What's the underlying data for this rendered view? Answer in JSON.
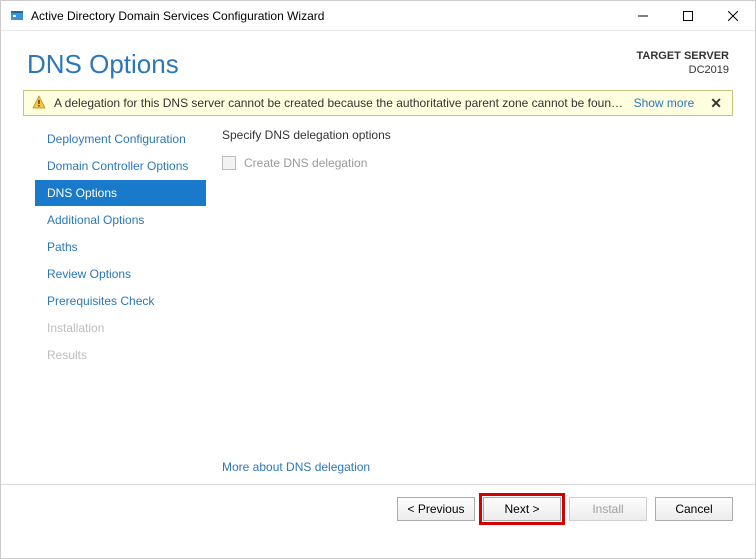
{
  "window": {
    "title": "Active Directory Domain Services Configuration Wizard"
  },
  "header": {
    "page_title": "DNS Options",
    "target_label": "TARGET SERVER",
    "target_server": "DC2019"
  },
  "warning": {
    "text": "A delegation for this DNS server cannot be created because the authoritative parent zone cannot be found...",
    "show_more": "Show more",
    "close": "×"
  },
  "nav": {
    "items": [
      {
        "label": "Deployment Configuration",
        "state": "normal"
      },
      {
        "label": "Domain Controller Options",
        "state": "normal"
      },
      {
        "label": "DNS Options",
        "state": "selected"
      },
      {
        "label": "Additional Options",
        "state": "normal"
      },
      {
        "label": "Paths",
        "state": "normal"
      },
      {
        "label": "Review Options",
        "state": "normal"
      },
      {
        "label": "Prerequisites Check",
        "state": "normal"
      },
      {
        "label": "Installation",
        "state": "disabled"
      },
      {
        "label": "Results",
        "state": "disabled"
      }
    ]
  },
  "content": {
    "heading": "Specify DNS delegation options",
    "checkbox_label": "Create DNS delegation",
    "more_link": "More about DNS delegation"
  },
  "footer": {
    "previous": "< Previous",
    "next": "Next >",
    "install": "Install",
    "cancel": "Cancel"
  }
}
